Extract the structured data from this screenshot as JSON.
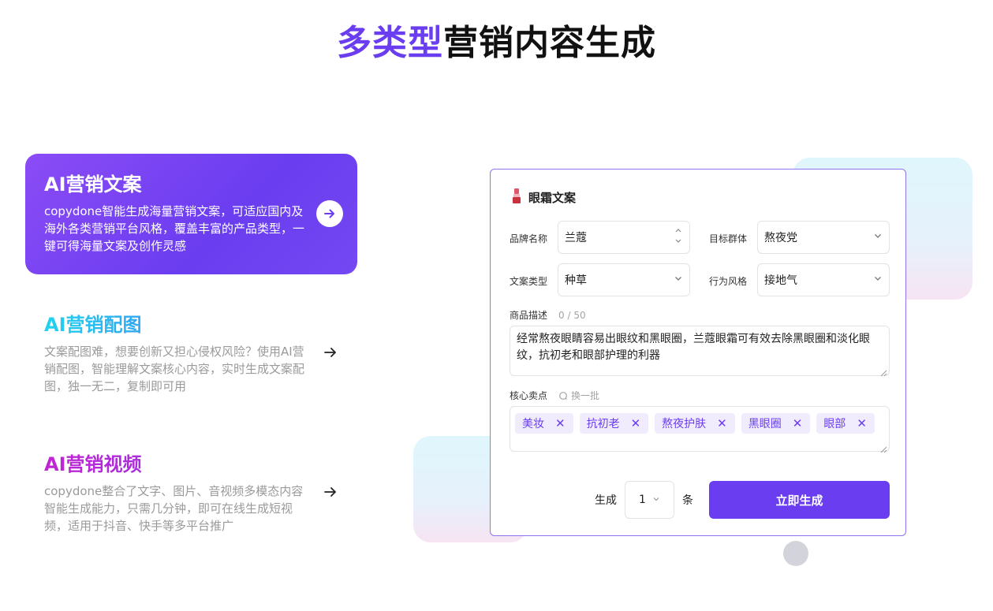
{
  "heading": {
    "accent": "多类型",
    "rest": "营销内容生成"
  },
  "features": [
    {
      "title": "AI营销文案",
      "desc": "copydone智能生成海量营销文案，可适应国内及海外各类营销平台风格，覆盖丰富的产品类型，一键可得海量文案及创作灵感",
      "active": true
    },
    {
      "title": "AI营销配图",
      "desc": "文案配图难，想要创新又担心侵权风险？使用AI营销配图，智能理解文案核心内容，实时生成文案配图，独一无二，复制即可用",
      "active": false
    },
    {
      "title": "AI营销视频",
      "desc": "copydone整合了文字、图片、音视频多模态内容智能生成能力，只需几分钟，即可在线生成短视频，适用于抖音、快手等多平台推广",
      "active": false
    }
  ],
  "form": {
    "title": "眼霜文案",
    "title_icon": "lipstick-icon",
    "brand": {
      "label": "品牌名称",
      "value": "兰蔻"
    },
    "target": {
      "label": "目标群体",
      "value": "熬夜党"
    },
    "copy_type": {
      "label": "文案类型",
      "value": "种草"
    },
    "style": {
      "label": "行为风格",
      "value": "接地气"
    },
    "desc": {
      "label": "商品描述",
      "counter": "0 / 50",
      "value": "经常熬夜眼睛容易出眼纹和黑眼圈，兰蔻眼霜可有效去除黑眼圈和淡化眼纹，抗初老和眼部护理的利器"
    },
    "selling_points": {
      "label": "核心卖点",
      "refresh": "换一批",
      "tags": [
        "美妆",
        "抗初老",
        "熬夜护肤",
        "黑眼圈",
        "眼部"
      ]
    },
    "generate": {
      "prefix": "生成",
      "count": "1",
      "suffix": "条",
      "button": "立即生成"
    }
  },
  "colors": {
    "accent": "#6a3df0",
    "card_border": "#8f74ee",
    "tag_bg": "#f0ecfd"
  }
}
